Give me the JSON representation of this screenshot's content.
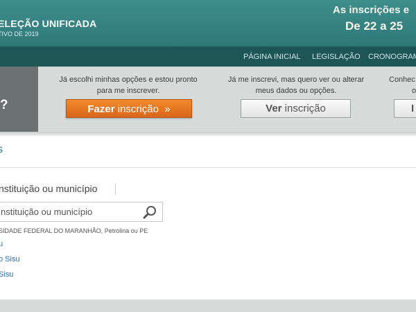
{
  "header": {
    "title": "ELEÇÃO UNIFICADA",
    "subtitle": "TIVO DE 2019",
    "inscricoes_line1": "As inscrições e",
    "inscricoes_line2": "De 22 a 25"
  },
  "nav": {
    "items": [
      {
        "label": "PÁGINA INICIAL"
      },
      {
        "label": "LEGISLAÇÃO"
      },
      {
        "label": "CRONOGRAMA"
      }
    ]
  },
  "cta": {
    "question_mark": "?",
    "col1_text": "Já escolhi minhas opções e estou pronto para me inscrever.",
    "col1_button_strong": "Fazer",
    "col1_button_rest": " inscrição  »",
    "col2_text": "Já me inscrevi, mas quero ver ou alterar meus dados ou opções.",
    "col2_button_strong": "Ver",
    "col2_button_rest": " inscrição",
    "col3_text": "Conhec",
    "col3_text2": "o",
    "col3_button": "I"
  },
  "section": {
    "letter": "s"
  },
  "search": {
    "label": "nstituição ou município",
    "placeholder": "nstituição ou município",
    "example": "SIDADE FEDERAL DO MARANHÃO, Petrolina ou PE"
  },
  "links": [
    {
      "label": "u"
    },
    {
      "label": "o Sisu"
    },
    {
      "label": "Sisu"
    }
  ],
  "colors": {
    "header": "#3e8e8e",
    "navbar": "#1e5656",
    "cta_background": "#d7dcdb",
    "orange_button": "#e8781f",
    "link": "#2b6fb5"
  }
}
